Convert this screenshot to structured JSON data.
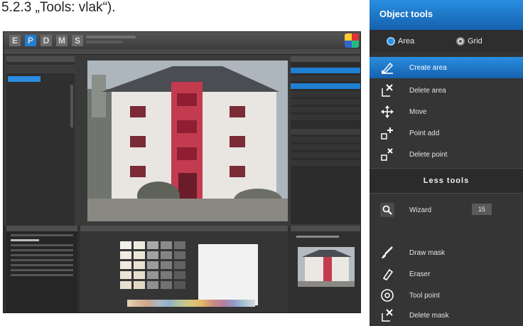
{
  "heading": "5.2.3 „Tools: vlak“).",
  "app": {
    "logo_letters": [
      "E",
      "P",
      "D",
      "M",
      "S"
    ],
    "active_logo_index": 1
  },
  "object_tools": {
    "title": "Object tools",
    "modes": [
      {
        "label": "Area",
        "selected": true
      },
      {
        "label": "Grid",
        "selected": false
      }
    ],
    "items": [
      {
        "label": "Create area",
        "icon": "create-area-icon",
        "active": true
      },
      {
        "label": "Delete area",
        "icon": "delete-area-icon",
        "active": false
      },
      {
        "label": "Move",
        "icon": "move-icon",
        "active": false
      },
      {
        "label": "Point add",
        "icon": "point-add-icon",
        "active": false
      },
      {
        "label": "Delete point",
        "icon": "delete-point-icon",
        "active": false
      }
    ],
    "less_tools_title": "Less tools",
    "wizard": {
      "label": "Wizard",
      "value": "15",
      "icon": "magnifier-icon"
    },
    "less_items": [
      {
        "label": "Draw mask",
        "icon": "brush-icon"
      },
      {
        "label": "Eraser",
        "icon": "eraser-icon"
      },
      {
        "label": "Tool point",
        "icon": "tool-point-icon"
      },
      {
        "label": "Delete mask",
        "icon": "delete-mask-icon"
      }
    ]
  },
  "colors": {
    "accent": "#1f7fd0",
    "panel": "#353535"
  }
}
